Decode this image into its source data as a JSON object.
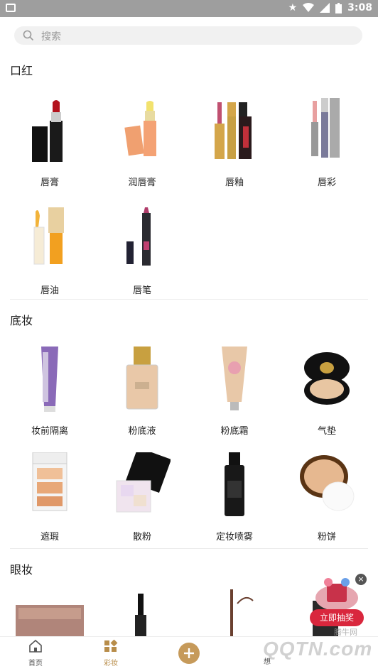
{
  "status_bar": {
    "time": "3:08"
  },
  "search": {
    "placeholder": "搜索"
  },
  "sections": [
    {
      "title": "口红",
      "items": [
        "唇膏",
        "润唇膏",
        "唇釉",
        "唇彩",
        "唇油",
        "唇笔"
      ]
    },
    {
      "title": "底妆",
      "items": [
        "妆前隔离",
        "粉底液",
        "粉底霜",
        "气垫",
        "遮瑕",
        "散粉",
        "定妆喷雾",
        "粉饼"
      ]
    },
    {
      "title": "眼妆",
      "items": []
    }
  ],
  "promo": {
    "label": "立即抽奖",
    "close": "×"
  },
  "bottom_nav": {
    "home": "首页",
    "makeup": "彩妆",
    "right_partial": "想"
  },
  "watermark": {
    "site": "腾牛网",
    "logo": "QQTN.com"
  },
  "colors": {
    "accent": "#b88d4a",
    "status_bar": "#9e9e9e",
    "promo_red": "#d9273d"
  }
}
